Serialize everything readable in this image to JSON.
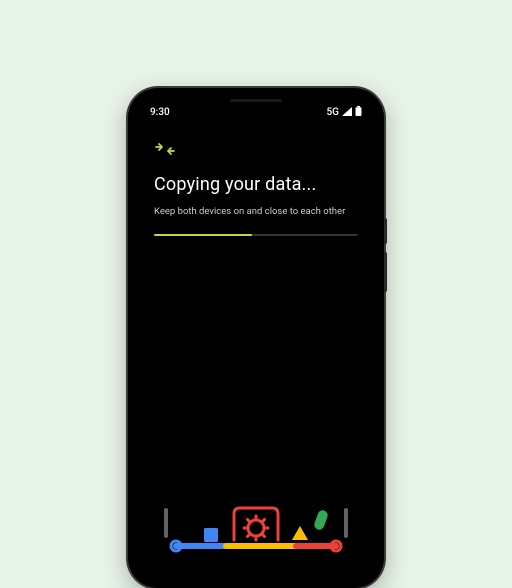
{
  "statusBar": {
    "time": "9:30",
    "network": "5G"
  },
  "screen": {
    "title": "Copying your data...",
    "subtitle": "Keep both devices on and close to each other",
    "progressPercent": 48
  },
  "icons": {
    "transfer": "transfer-arrows-icon",
    "signal": "signal-icon",
    "battery": "battery-icon"
  },
  "illustration": {
    "description": "conveyor-belt-data-transfer",
    "colors": {
      "conveyorLeft": "#4285f4",
      "conveyorMid": "#fbbc04",
      "conveyorRight": "#ea4335",
      "gear": "#ea4335",
      "arch": "#ea4335",
      "blueBox": "#4285f4",
      "greenPill": "#34a853",
      "yellowTriangle": "#fbbc04",
      "bumper": "#5f6368"
    }
  }
}
